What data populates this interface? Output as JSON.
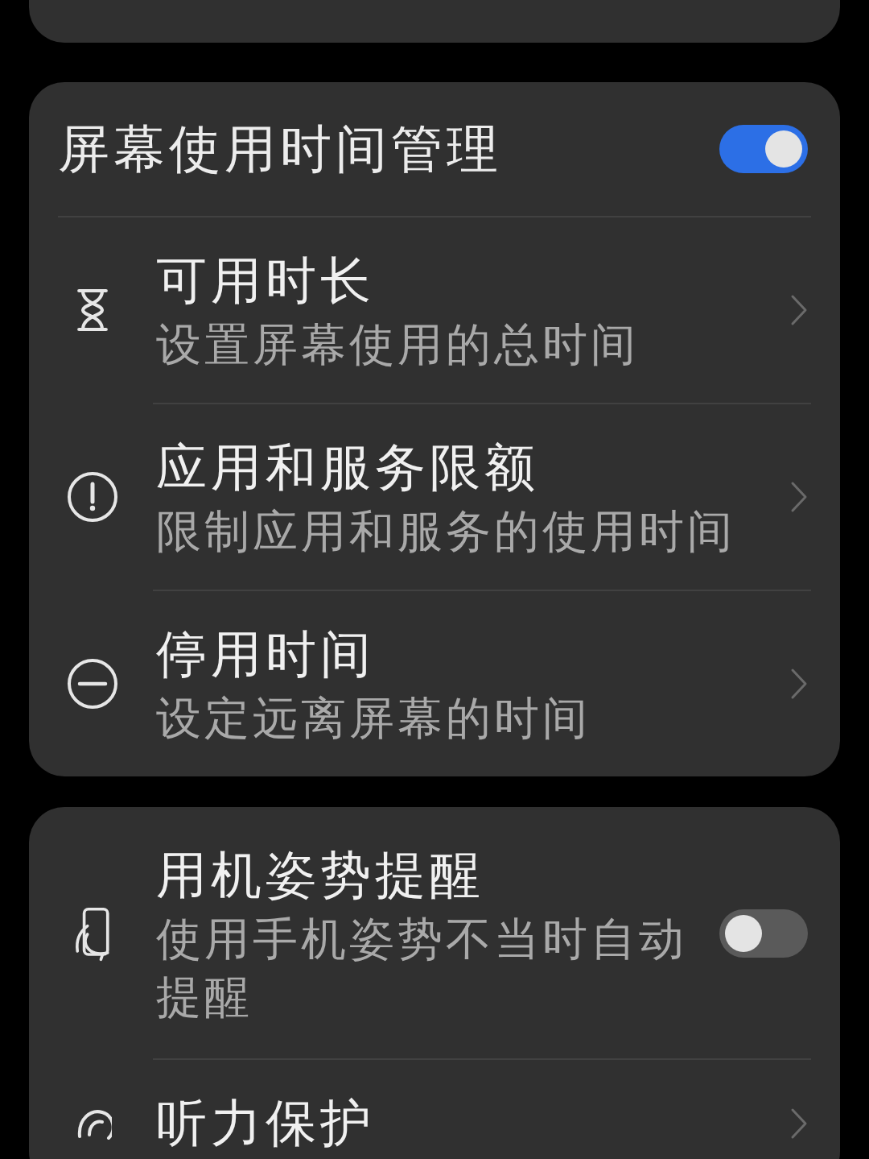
{
  "sections": [
    {
      "header": {
        "title": "屏幕使用时间管理",
        "on": true
      },
      "items": [
        {
          "kind": "link",
          "title": "可用时长",
          "subtitle": "设置屏幕使用的总时间"
        },
        {
          "kind": "link",
          "title": "应用和服务限额",
          "subtitle": "限制应用和服务的使用时间"
        },
        {
          "kind": "link",
          "title": "停用时间",
          "subtitle": "设定远离屏幕的时间"
        }
      ]
    },
    {
      "items": [
        {
          "kind": "toggle",
          "title": "用机姿势提醒",
          "subtitle": "使用手机姿势不当时自动提醒",
          "on": false
        },
        {
          "kind": "link",
          "title": "听力保护"
        }
      ]
    }
  ]
}
